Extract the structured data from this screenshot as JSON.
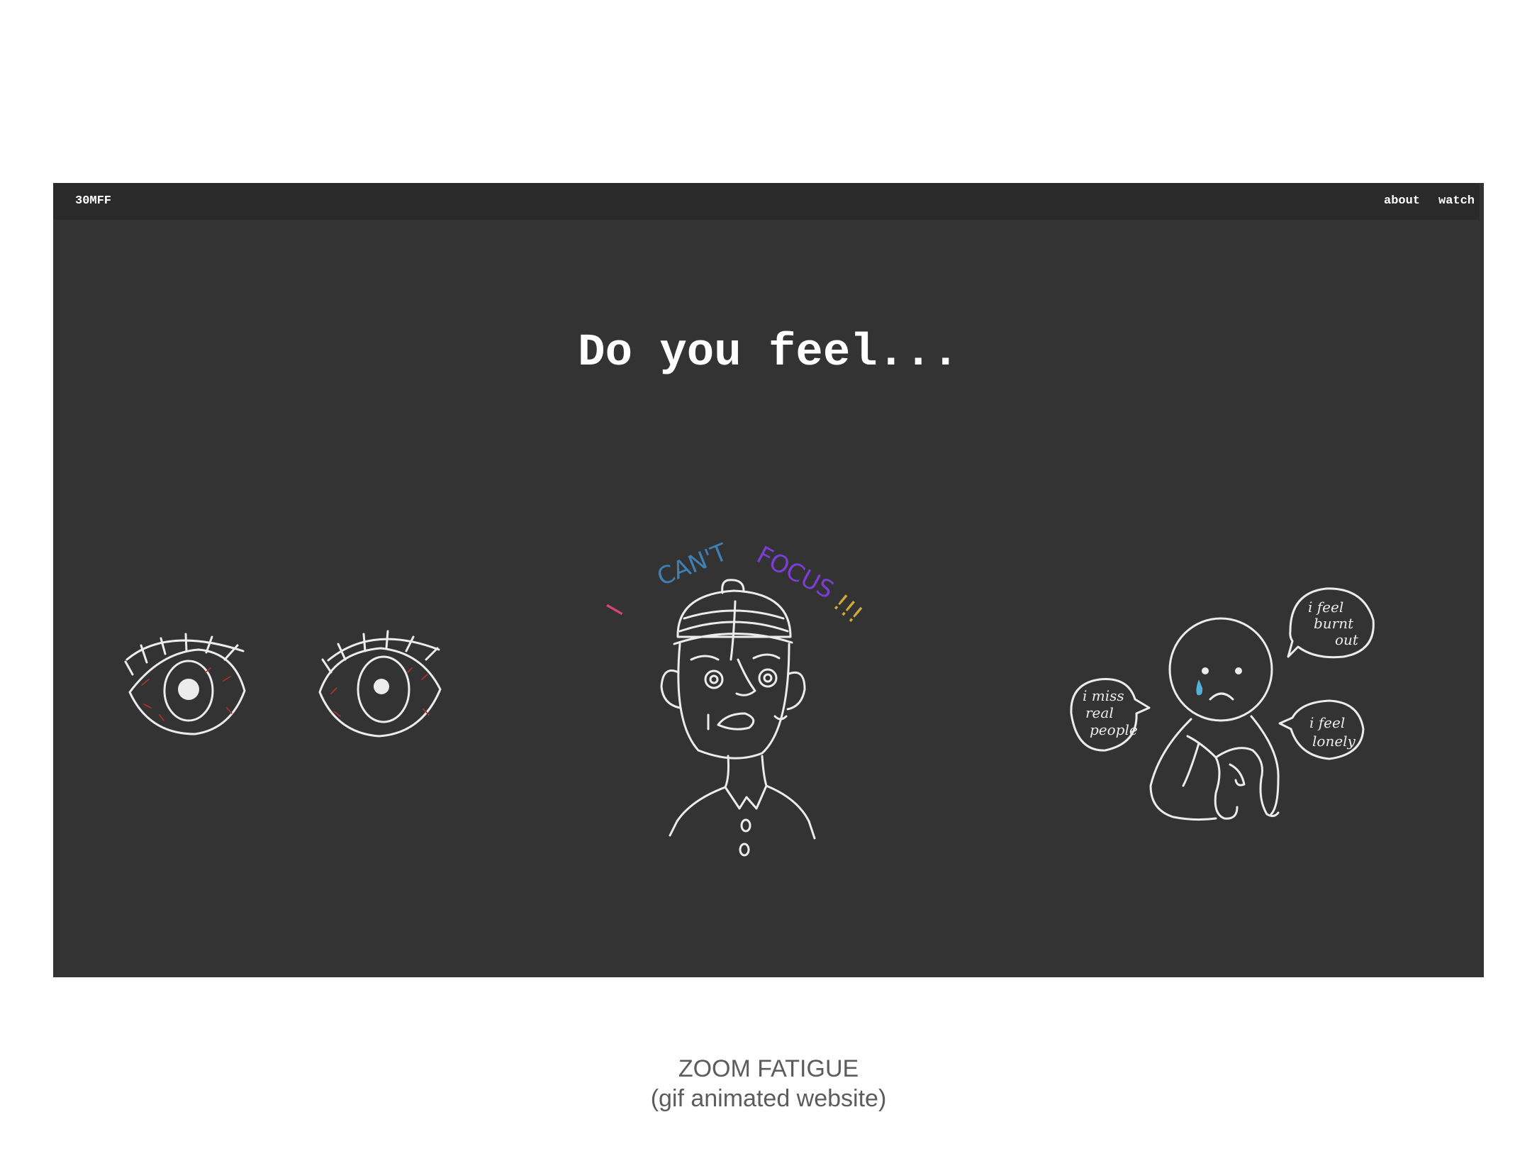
{
  "navbar": {
    "brand": "30MFF",
    "links": [
      "about",
      "watch"
    ]
  },
  "hero": {
    "headline": "Do you feel..."
  },
  "illustrations": {
    "focus_text": {
      "words": [
        "I",
        "CAN'T",
        "FOCUS",
        "!!!"
      ],
      "colors": [
        "#d2477a",
        "#3f7fb4",
        "#7a3ed1",
        "#d1a93a"
      ]
    },
    "bubbles": [
      {
        "lines": [
          "i feel",
          "burnt",
          "out"
        ]
      },
      {
        "lines": [
          "i miss",
          "real",
          "people"
        ]
      },
      {
        "lines": [
          "i feel",
          "lonely"
        ]
      }
    ]
  },
  "caption": {
    "title": "ZOOM FATIGUE",
    "subtitle": "(gif animated website)"
  },
  "colors": {
    "page_background": "#ffffff",
    "screen_background": "#333333",
    "navbar_background": "#2b2a2b",
    "text_light": "#ffffff",
    "caption_text": "#5c5c5c",
    "tear": "#4fb3d9"
  }
}
